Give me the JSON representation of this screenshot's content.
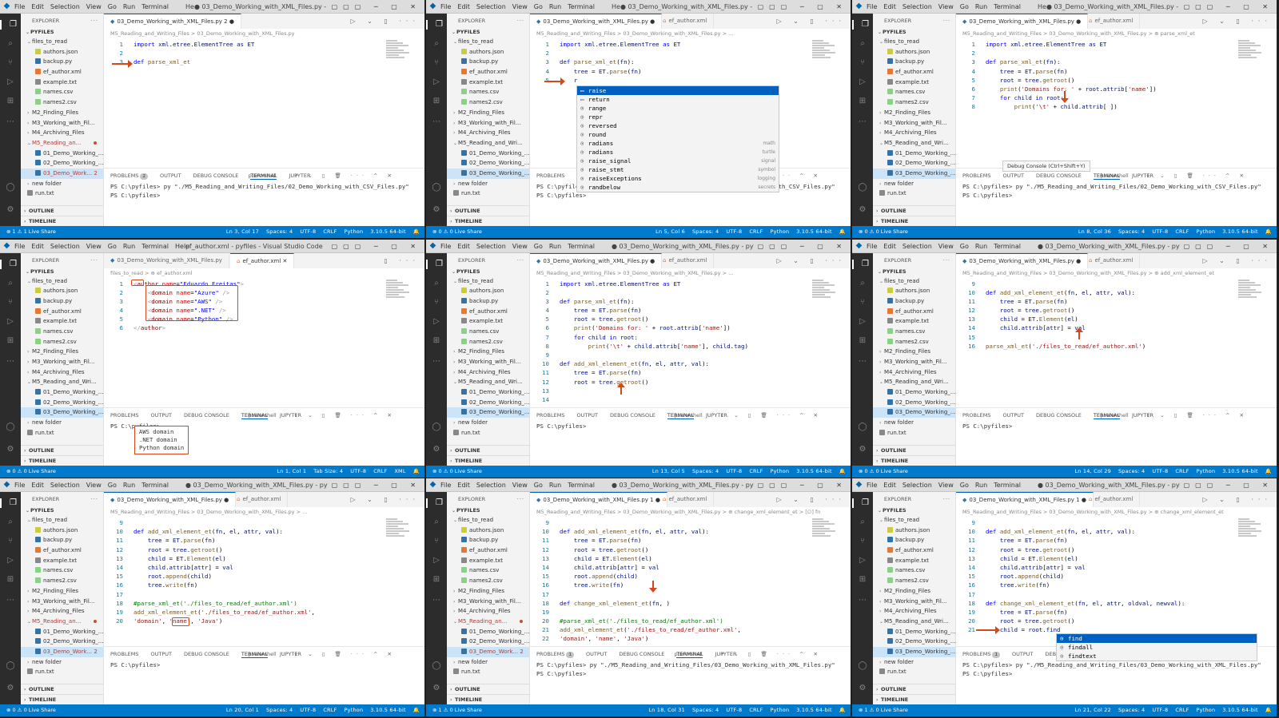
{
  "menu": [
    "File",
    "Edit",
    "Selection",
    "View",
    "Go",
    "Run",
    "Terminal",
    "Help"
  ],
  "panes": [
    {
      "title": "He● 03_Demo_Working_with_XML_Files.py - pyfiles - Visual ...",
      "tabs": [
        {
          "label": "03_Demo_Working_with_XML_Files.py 2",
          "type": "py",
          "on": true,
          "mod": true
        }
      ],
      "crumb": "M5_Reading_and_Writing_Files > 03_Demo_Working_with_XML_Files.py",
      "code": [
        "import xml.etree.ElementTree as ET",
        "",
        "def parse_xml_et"
      ],
      "problems_badge": "2",
      "term": [
        "PS C:\\pyfiles> py \"./M5_Reading_and_Writing_Files/02_Demo_Working_with_CSV_Files.py\"",
        "PS C:\\pyfiles> "
      ],
      "status_left": "⊗ 1 ⚠ 1   Live Share",
      "status_right": [
        "Ln 3, Col 17",
        "Spaces: 4",
        "UTF-8",
        "CRLF",
        "Python",
        "3.10.5 64-bit"
      ]
    },
    {
      "title": "He● 03_Demo_Working_with_XML_Files.py - pyfiles - Visual ...",
      "tabs": [
        {
          "label": "03_Demo_Working_with_XML_Files.py",
          "type": "py",
          "on": true,
          "mod": true
        },
        {
          "label": "ef_author.xml",
          "type": "xml",
          "on": false
        }
      ],
      "crumb": "M5_Reading_and_Writing_Files > 03_Demo_Working_with_XML_Files.py > ...",
      "code": [
        "import xml.etree.ElementTree as ET",
        "",
        "def parse_xml_et(fn):",
        "    tree = ET.parse(fn)",
        "    r"
      ],
      "suggestions": [
        {
          "label": "raise",
          "detail": ""
        },
        {
          "label": "return",
          "detail": ""
        },
        {
          "label": "range",
          "detail": ""
        },
        {
          "label": "repr",
          "detail": ""
        },
        {
          "label": "reversed",
          "detail": ""
        },
        {
          "label": "round",
          "detail": ""
        },
        {
          "label": "radians",
          "detail": "math"
        },
        {
          "label": "radians",
          "detail": "turtle"
        },
        {
          "label": "raise_signal",
          "detail": "signal"
        },
        {
          "label": "raise_stmt",
          "detail": "symbol"
        },
        {
          "label": "raiseExceptions",
          "detail": "logging"
        },
        {
          "label": "randbelow",
          "detail": "secrets"
        }
      ],
      "term": [
        "PS C:\\pyfiles> py \"./M5_Reading_and_Writing_Files/02_Demo_Working_with_CSV_Files.py\"",
        "PS C:\\pyfiles> "
      ],
      "status_left": "⊗ 0 ⚠ 0   Live Share",
      "status_right": [
        "Ln 5, Col 6",
        "Spaces: 4",
        "UTF-8",
        "CRLF",
        "Python",
        "3.10.5 64-bit"
      ]
    },
    {
      "title": "He● 03_Demo_Working_with_XML_Files.py - pyfiles - Visual ...",
      "tabs": [
        {
          "label": "03_Demo_Working_with_XML_Files.py",
          "type": "py",
          "on": true,
          "mod": true
        },
        {
          "label": "ef_author.xml",
          "type": "xml",
          "on": false
        }
      ],
      "crumb": "M5_Reading_and_Writing_Files > 03_Demo_Working_with_XML_Files.py > ⊕ parse_xml_et",
      "code": [
        "import xml.etree.ElementTree as ET",
        "",
        "def parse_xml_et(fn):",
        "    tree = ET.parse(fn)",
        "    root = tree.getroot()",
        "    print('Domains for: ' + root.attrib['name'])",
        "    for child in root:",
        "        print('\\t' + child.attrib[ ])"
      ],
      "tooltip": "Debug Console (Ctrl+Shift+Y)",
      "term": [
        "PS C:\\pyfiles> py \"./M5_Reading_and_Writing_Files/02_Demo_Working_with_CSV_Files.py\"",
        "PS C:\\pyfiles> "
      ],
      "status_left": "⊗ 0 ⚠ 0   Live Share",
      "status_right": [
        "Ln 8, Col 36",
        "Spaces: 4",
        "UTF-8",
        "CRLF",
        "Python",
        "3.10.5 64-bit"
      ]
    },
    {
      "title": "ef_author.xml - pyfiles - Visual Studio Code",
      "tabs": [
        {
          "label": "03_Demo_Working_with_XML_Files.py",
          "type": "py",
          "on": false
        },
        {
          "label": "ef_author.xml",
          "type": "xml",
          "on": true,
          "close": true
        }
      ],
      "crumb": "files_to_read > ⊕ ef_author.xml",
      "code": [
        "<author name=\"Eduardo Freitas\">",
        "    <domain name=\"Azure\" />",
        "    <domain name=\"AWS\" />",
        "    <domain name=\".NET\" />",
        "    <domain name=\"Python\" />",
        "</author>"
      ],
      "term_box": [
        "AWS domain",
        ".NET domain",
        "Python domain"
      ],
      "term": [
        "PS C:\\pyfiles> "
      ],
      "status_left": "⊗ 0 ⚠ 0   Live Share",
      "status_right": [
        "Ln 1, Col 1",
        "Tab Size: 4",
        "UTF-8",
        "CRLF",
        "XML"
      ]
    },
    {
      "title": "● 03_Demo_Working_with_XML_Files.py - pyfiles - Visual ...",
      "tabs": [
        {
          "label": "03_Demo_Working_with_XML_Files.py",
          "type": "py",
          "on": true,
          "mod": true
        },
        {
          "label": "ef_author.xml",
          "type": "xml",
          "on": false
        }
      ],
      "crumb": "M5_Reading_and_Writing_Files > 03_Demo_Working_with_XML_Files.py > ...",
      "code": [
        "import xml.etree.ElementTree as ET",
        "",
        "def parse_xml_et(fn):",
        "    tree = ET.parse(fn)",
        "    root = tree.getroot()",
        "    print('Domains for: ' + root.attrib['name'])",
        "    for child in root:",
        "        print('\\t' + child.attrib['name'], child.tag)",
        "",
        "def add_xml_element_et(fn, el, attr, val):",
        "    tree = ET.parse(fn)",
        "    root = tree.getroot()",
        "",
        ""
      ],
      "term": [
        "",
        "PS C:\\pyfiles> "
      ],
      "status_left": "⊗ 0 ⚠ 0   Live Share",
      "status_right": [
        "Ln 13, Col 5",
        "Spaces: 4",
        "UTF-8",
        "CRLF",
        "Python",
        "3.10.5 64-bit"
      ]
    },
    {
      "title": "● 03_Demo_Working_with_XML_Files.py - pyfiles - Visual ...",
      "tabs": [
        {
          "label": "03_Demo_Working_with_XML_Files.py",
          "type": "py",
          "on": true,
          "mod": true
        },
        {
          "label": "ef_author.xml",
          "type": "xml",
          "on": false
        }
      ],
      "crumb": "M5_Reading_and_Writing_Files > 03_Demo_Working_with_XML_Files.py > ⊕ add_xml_element_et",
      "start": 9,
      "code": [
        "",
        "def add_xml_element_et(fn, el, attr, val):",
        "    tree = ET.parse(fn)",
        "    root = tree.getroot()",
        "    child = ET.Element(el)",
        "    child.attrib[attr] = val",
        "",
        "parse_xml_et('./files_to_read/ef_author.xml')"
      ],
      "term": [
        "",
        "PS C:\\pyfiles> "
      ],
      "status_left": "⊗ 0 ⚠ 0   Live Share",
      "status_right": [
        "Ln 14, Col 29",
        "Spaces: 4",
        "UTF-8",
        "CRLF",
        "Python",
        "3.10.5 64-bit"
      ]
    },
    {
      "title": "● 03_Demo_Working_with_XML_Files.py - pyfiles - Visual ...",
      "tabs": [
        {
          "label": "03_Demo_Working_with_XML_Files.py",
          "type": "py",
          "on": true,
          "mod": true
        },
        {
          "label": "ef_author.xml",
          "type": "xml",
          "on": false
        }
      ],
      "crumb": "M5_Reading_and_Writing_Files > 03_Demo_Working_with_XML_Files.py > ...",
      "start": 9,
      "code": [
        "",
        "def add_xml_element_et(fn, el, attr, val):",
        "    tree = ET.parse(fn)",
        "    root = tree.getroot()",
        "    child = ET.Element(el)",
        "    child.attrib[attr] = val",
        "    root.append(child)",
        "    tree.write(fn)",
        "",
        "#parse_xml_et('./files_to_read/ef_author.xml')",
        "add_xml_element_et('./files_to_read/ef_author.xml',",
        "'domain', 'name', 'Java')"
      ],
      "term": [
        "",
        "PS C:\\pyfiles> "
      ],
      "status_left": "⊗ 0 ⚠ 0   Live Share",
      "status_right": [
        "Ln 20, Col 1",
        "Spaces: 4",
        "UTF-8",
        "CRLF",
        "Python",
        "3.10.5 64-bit"
      ]
    },
    {
      "title": "● 03_Demo_Working_with_XML_Files.py - pyfiles - Visual ...",
      "tabs": [
        {
          "label": "03_Demo_Working_with_XML_Files.py 1",
          "type": "py",
          "on": true,
          "mod": true
        },
        {
          "label": "ef_author.xml",
          "type": "xml",
          "on": false
        }
      ],
      "crumb": "M5_Reading_and_Writing_Files > 03_Demo_Working_with_XML_Files.py > ⊕ change_xml_element_et > [∅] fn",
      "start": 9,
      "code": [
        "",
        "def add_xml_element_et(fn, el, attr, val):",
        "    tree = ET.parse(fn)",
        "    root = tree.getroot()",
        "    child = ET.Element(el)",
        "    child.attrib[attr] = val",
        "    root.append(child)",
        "    tree.write(fn)",
        "",
        "def change_xml_element_et(fn, )",
        "",
        "#parse_xml_et('./files_to_read/ef_author.xml')",
        "add_xml_element_et('./files_to_read/ef_author.xml',",
        "'domain', 'name', 'Java')"
      ],
      "problems_badge": "1",
      "term": [
        "PS C:\\pyfiles> py \"./M5_Reading_and_Writing_Files/03_Demo_Working_with_XML_Files.py\"",
        "PS C:\\pyfiles> "
      ],
      "status_left": "⊗ 1 ⚠ 0   Live Share",
      "status_right": [
        "Ln 18, Col 31",
        "Spaces: 4",
        "UTF-8",
        "CRLF",
        "Python",
        "3.10.5 64-bit"
      ]
    },
    {
      "title": "● 03_Demo_Working_with_XML_Files.py - pyfiles - Visual ...",
      "tabs": [
        {
          "label": "03_Demo_Working_with_XML_Files.py 1",
          "type": "py",
          "on": true,
          "mod": true
        },
        {
          "label": "ef_author.xml",
          "type": "xml",
          "on": false
        }
      ],
      "crumb": "M5_Reading_and_Writing_Files > 03_Demo_Working_with_XML_Files.py > ⊕ change_xml_element_et",
      "start": 9,
      "code": [
        "",
        "def add_xml_element_et(fn, el, attr, val):",
        "    tree = ET.parse(fn)",
        "    root = tree.getroot()",
        "    child = ET.Element(el)",
        "    child.attrib[attr] = val",
        "    root.append(child)",
        "    tree.write(fn)",
        "",
        "def change_xml_element_et(fn, el, attr, oldval, newval):",
        "    tree = ET.parse(fn)",
        "    root = tree.getroot()",
        "    child = root.find"
      ],
      "suggestions": [
        {
          "label": "find",
          "detail": ""
        },
        {
          "label": "findall",
          "detail": ""
        },
        {
          "label": "findtext",
          "detail": ""
        }
      ],
      "problems_badge": "1",
      "term": [
        "PS C:\\pyfiles> py \"./M5_Reading_and_Writing_Files/03_Demo_Working_with_XML_Files.py\"",
        "PS C:\\pyfiles> "
      ],
      "status_left": "⊗ 1 ⚠ 0   Live Share",
      "status_right": [
        "Ln 21, Col 22",
        "Spaces: 4",
        "UTF-8",
        "CRLF",
        "Python",
        "3.10.5 64-bit"
      ]
    }
  ],
  "explorer": {
    "header": "EXPLORER",
    "root": "PYFILES",
    "rows_a": [
      {
        "label": "files_to_read",
        "kind": "folder",
        "depth": 1,
        "open": true
      },
      {
        "label": "authors.json",
        "kind": "json",
        "depth": 2
      },
      {
        "label": "backup.py",
        "kind": "py",
        "depth": 2
      },
      {
        "label": "ef_author.xml",
        "kind": "xml",
        "depth": 2
      },
      {
        "label": "example.txt",
        "kind": "txt",
        "depth": 2
      },
      {
        "label": "names.csv",
        "kind": "csv",
        "depth": 2
      },
      {
        "label": "names2.csv",
        "kind": "csv",
        "depth": 2
      },
      {
        "label": "M2_Finding_Files",
        "kind": "folder",
        "depth": 1
      },
      {
        "label": "M3_Working_with_Fil...",
        "kind": "folder",
        "depth": 1
      },
      {
        "label": "M4_Archiving_Files",
        "kind": "folder",
        "depth": 1
      },
      {
        "label": "M5_Reading_an...",
        "kind": "folder",
        "depth": 1,
        "open": true,
        "mod": true
      },
      {
        "label": "01_Demo_Working_...",
        "kind": "py",
        "depth": 2
      },
      {
        "label": "02_Demo_Working_...",
        "kind": "py",
        "depth": 2
      },
      {
        "label": "03_Demo_Work... 2",
        "kind": "py",
        "depth": 2,
        "sel": true,
        "mod": true
      },
      {
        "label": "new folder",
        "kind": "folder",
        "depth": 1
      },
      {
        "label": "run.txt",
        "kind": "txt",
        "depth": 1
      }
    ],
    "rows_b": [
      {
        "label": "files_to_read",
        "kind": "folder",
        "depth": 1,
        "open": true
      },
      {
        "label": "authors.json",
        "kind": "json",
        "depth": 2
      },
      {
        "label": "backup.py",
        "kind": "py",
        "depth": 2
      },
      {
        "label": "ef_author.xml",
        "kind": "xml",
        "depth": 2
      },
      {
        "label": "example.txt",
        "kind": "txt",
        "depth": 2
      },
      {
        "label": "names.csv",
        "kind": "csv",
        "depth": 2
      },
      {
        "label": "names2.csv",
        "kind": "csv",
        "depth": 2
      },
      {
        "label": "M2_Finding_Files",
        "kind": "folder",
        "depth": 1
      },
      {
        "label": "M3_Working_with_Fil...",
        "kind": "folder",
        "depth": 1
      },
      {
        "label": "M4_Archiving_Files",
        "kind": "folder",
        "depth": 1
      },
      {
        "label": "M5_Reading_and_Wri...",
        "kind": "folder",
        "depth": 1,
        "open": true
      },
      {
        "label": "01_Demo_Working_...",
        "kind": "py",
        "depth": 2
      },
      {
        "label": "02_Demo_Working_...",
        "kind": "py",
        "depth": 2
      },
      {
        "label": "03_Demo_Working_...",
        "kind": "py",
        "depth": 2,
        "sel": true
      },
      {
        "label": "new folder",
        "kind": "folder",
        "depth": 1
      },
      {
        "label": "run.txt",
        "kind": "txt",
        "depth": 1
      }
    ],
    "outline": "OUTLINE",
    "timeline": "TIMELINE"
  },
  "panel_tabs": [
    "PROBLEMS",
    "OUTPUT",
    "DEBUG CONSOLE",
    "TERMINAL",
    "JUPYTER"
  ],
  "terminal_shell": "powershell",
  "colors": {
    "accent": "#007acc",
    "arrow": "#d24a1c",
    "selection": "#0060c0"
  }
}
